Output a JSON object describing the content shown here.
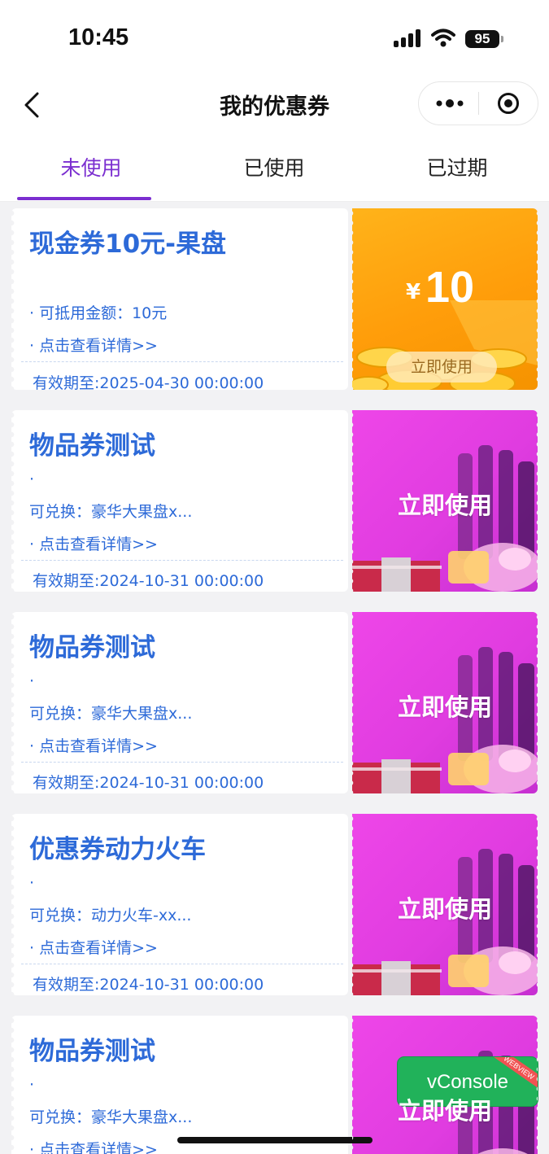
{
  "status_bar": {
    "time": "10:45",
    "battery": "95"
  },
  "navbar": {
    "title": "我的优惠券"
  },
  "tabs": [
    {
      "label": "未使用",
      "active": true
    },
    {
      "label": "已使用",
      "active": false
    },
    {
      "label": "已过期",
      "active": false
    }
  ],
  "coupons": [
    {
      "title": "现金券10元-果盘",
      "bullet": "· 可抵用金额：10元",
      "details": "· 点击查看详情>>",
      "expiry": "有效期至:2025-04-30 00:00:00",
      "currency": "¥",
      "amount": "10",
      "use_label": "立即使用",
      "style": "cash"
    },
    {
      "title": "物品券测试",
      "dot": "·",
      "exchange": "可兑换：豪华大果盘x...",
      "details": "· 点击查看详情>>",
      "expiry": "有效期至:2024-10-31 00:00:00",
      "use_label": "立即使用",
      "style": "item"
    },
    {
      "title": "物品券测试",
      "dot": "·",
      "exchange": "可兑换：豪华大果盘x...",
      "details": "· 点击查看详情>>",
      "expiry": "有效期至:2024-10-31 00:00:00",
      "use_label": "立即使用",
      "style": "item"
    },
    {
      "title": "优惠券动力火车",
      "dot": "·",
      "exchange": "可兑换：动力火车-xx...",
      "details": "· 点击查看详情>>",
      "expiry": "有效期至:2024-10-31 00:00:00",
      "use_label": "立即使用",
      "style": "item"
    },
    {
      "title": "物品券测试",
      "dot": "·",
      "exchange": "可兑换：豪华大果盘x...",
      "details": "· 点击查看详情>>",
      "expiry": "",
      "use_label": "立即使用",
      "style": "item"
    }
  ],
  "vconsole": {
    "label": "vConsole",
    "tag": "WEBVIEW"
  },
  "colors": {
    "accent": "#7b2fd0",
    "coupon_text": "#2d6ad8",
    "cash_bg": "#ffa214",
    "item_bg": "#e33fe3",
    "vconsole_bg": "#21b25a"
  }
}
